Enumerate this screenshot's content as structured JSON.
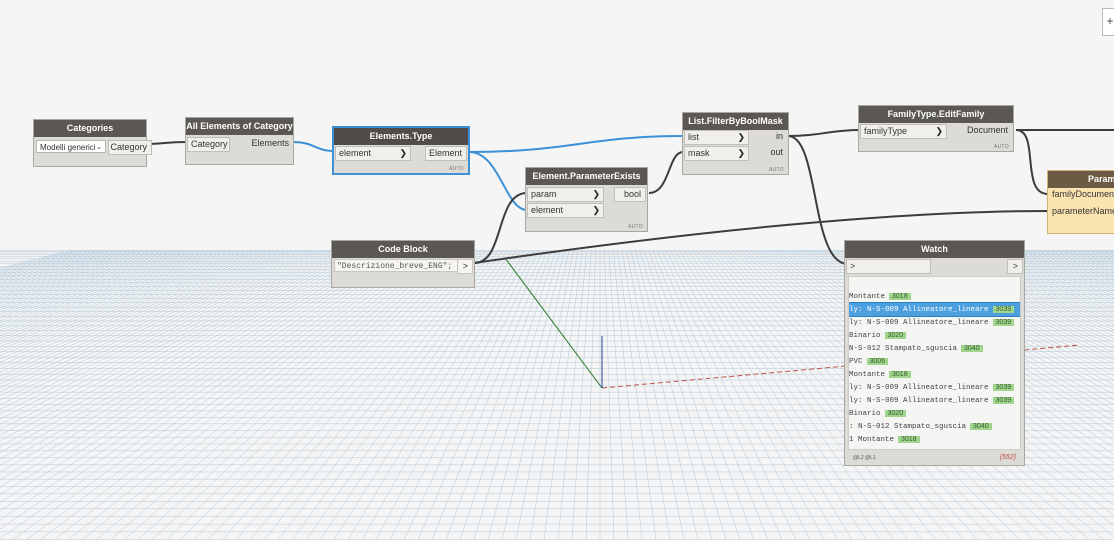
{
  "nodes": {
    "categories": {
      "title": "Categories",
      "dropdown_value": "Modelli generici",
      "out_port": "Category"
    },
    "all_elements": {
      "title": "All Elements of Category",
      "in_port": "Category",
      "out_port": "Elements"
    },
    "elements_type": {
      "title": "Elements.Type",
      "in_port": "element",
      "out_port": "Element",
      "lacing": "AUTO"
    },
    "param_exists": {
      "title": "Element.ParameterExists",
      "in_ports": [
        "param",
        "element"
      ],
      "out_port": "bool",
      "lacing": "AUTO"
    },
    "filter": {
      "title": "List.FilterByBoolMask",
      "in_ports": [
        "list",
        "mask"
      ],
      "out_ports": [
        "in",
        "out"
      ],
      "lacing": "AUTO"
    },
    "edit_family": {
      "title": "FamilyType.EditFamily",
      "in_port": "familyType",
      "out_port": "Document",
      "lacing": "AUTO"
    },
    "param_node": {
      "title": "Param",
      "in_ports": [
        "familyDocument",
        "parameterName"
      ]
    },
    "code_block": {
      "title": "Code Block",
      "code": "\"Descrizione_breve_ENG\";",
      "out_arrow": ">"
    },
    "watch": {
      "title": "Watch",
      "in_arrow": ">",
      "out_arrow": ">",
      "lines": [
        {
          "text": " Montante",
          "count": "3018",
          "selected": false
        },
        {
          "text": "ly: N-S-009 Allineatore_lineare",
          "count": "3039",
          "selected": true
        },
        {
          "text": "ly: N-S-009 Allineatore_lineare",
          "count": "3039",
          "selected": false
        },
        {
          "text": "Binario",
          "count": "3020",
          "selected": false
        },
        {
          "text": " N-S-012 Stampato_sguscia",
          "count": "3040",
          "selected": false
        },
        {
          "text": " PVC",
          "count": "3006",
          "selected": false
        },
        {
          "text": " Montante",
          "count": "3018",
          "selected": false
        },
        {
          "text": "ly: N-S-009 Allineatore_lineare",
          "count": "3039",
          "selected": false
        },
        {
          "text": "ly: N-S-009 Allineatore_lineare",
          "count": "3039",
          "selected": false
        },
        {
          "text": "Binario",
          "count": "3020",
          "selected": false
        },
        {
          "text": ": N-S-012 Stampato_sguscia",
          "count": "3040",
          "selected": false
        },
        {
          "text": "1 Montante",
          "count": "3018",
          "selected": false
        }
      ],
      "levels": "@L2 @L1",
      "total": "{552}"
    }
  },
  "colors": {
    "header": "#5a5754",
    "node_body": "#dddbd6",
    "wire": "#3c3c3c",
    "wire_selected": "#3d8fd6",
    "count_badge": "#9fd58c",
    "param_header": "#6b5a44",
    "param_body": "#fbe3b0"
  }
}
